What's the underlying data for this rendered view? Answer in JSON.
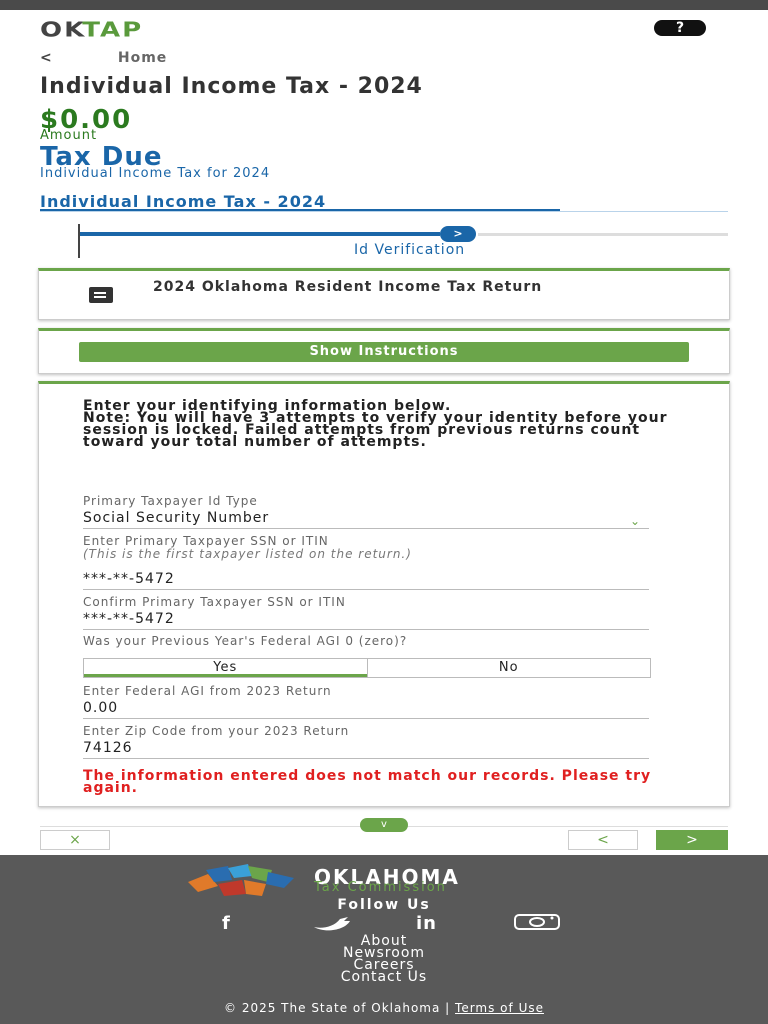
{
  "header": {
    "logo_ok": "OK",
    "logo_tap": "TAP",
    "help_label": "?"
  },
  "breadcrumb": {
    "back_label": "<",
    "home_label": "Home"
  },
  "page": {
    "title": "Individual Income Tax - 2024",
    "amount": "$0.00",
    "amount_label": "Amount",
    "tax_due_title": "Tax Due",
    "tax_due_subtitle": "Individual Income Tax for 2024"
  },
  "section": {
    "tab_label": "Individual Income Tax - 2024"
  },
  "stepper": {
    "current_step_label": "Id Verification",
    "dot_symbol": ">"
  },
  "return_card": {
    "title": "2024 Oklahoma Resident Income Tax Return"
  },
  "instructions": {
    "button_label": "Show Instructions"
  },
  "form": {
    "intro_line1": "Enter your identifying information below.",
    "intro_line2": "Note: You will have 3 attempts to verify your identity before your session is locked. Failed attempts from previous returns count toward your total number of attempts.",
    "id_type_label": "Primary Taxpayer Id Type",
    "id_type_value": "Social Security Number",
    "ssn_label": "Enter Primary Taxpayer SSN or ITIN",
    "ssn_hint": "(This is the first taxpayer listed on the return.)",
    "ssn_value": "***-**-5472",
    "ssn_confirm_label": "Confirm Primary Taxpayer SSN or ITIN",
    "ssn_confirm_value": "***-**-5472",
    "agi_zero_question": "Was your Previous Year's Federal AGI 0 (zero)?",
    "agi_zero_yes": "Yes",
    "agi_zero_no": "No",
    "agi_label": "Enter Federal AGI from 2023 Return",
    "agi_value": "0.00",
    "zip_label": "Enter Zip Code from your 2023 Return",
    "zip_value": "74126",
    "error_message": "The information entered does not match our records. Please try again."
  },
  "actions": {
    "expand_symbol": "v",
    "cancel_symbol": "×",
    "prev_symbol": "<",
    "next_symbol": ">"
  },
  "footer": {
    "org_name": "OKLAHOMA",
    "org_sub": "Tax Commission",
    "follow_label": "Follow Us",
    "social_facebook": "f",
    "social_linkedin": "in",
    "links": [
      "About",
      "Newsroom",
      "Careers",
      "Contact Us"
    ],
    "copyright": "© 2025 The State of Oklahoma | ",
    "terms_label": "Terms of Use"
  },
  "colors": {
    "brand_green": "#6ba54a",
    "brand_blue": "#1a66a8",
    "error_red": "#e02020",
    "footer_gray": "#595959"
  },
  "icons": [
    "help-icon",
    "back-chevron-icon",
    "document-icon",
    "select-chevron-icon",
    "facebook-icon",
    "twitter-icon",
    "linkedin-icon",
    "instagram-icon",
    "close-icon"
  ]
}
